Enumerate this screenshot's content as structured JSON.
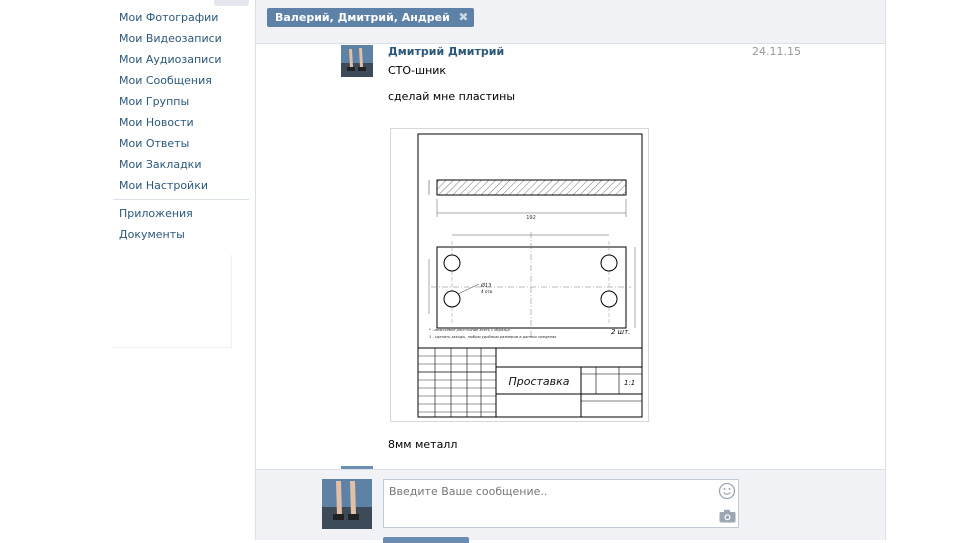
{
  "sidebar": {
    "items": [
      {
        "label": "Мои Фотографии"
      },
      {
        "label": "Мои Видеозаписи"
      },
      {
        "label": "Мои Аудиозаписи"
      },
      {
        "label": "Мои Сообщения"
      },
      {
        "label": "Мои Группы"
      },
      {
        "label": "Мои Новости"
      },
      {
        "label": "Мои Ответы"
      },
      {
        "label": "Мои Закладки"
      },
      {
        "label": "Мои Настройки"
      }
    ],
    "extra": [
      {
        "label": "Приложения"
      },
      {
        "label": "Документы"
      }
    ]
  },
  "chat": {
    "tab_label": "Валерий, Дмитрий, Андрей",
    "close_symbol": "✖"
  },
  "message": {
    "author": "Дмитрий Дмитрий",
    "date": "24.11.15",
    "line1": "СТО-шник",
    "line2": "сделай мне пластины",
    "line3": "8мм металл"
  },
  "drawing": {
    "title": "Проставка",
    "scale": "1:1",
    "quantity": "2 шт.",
    "dim_length": "192",
    "dim_hole": "Ø13",
    "dim_hole_note": "4 отв.",
    "note1": "* - межосевое расстояние взять с образца",
    "note2": "1 - сделать заходы, любым удобным размером в данных пределах"
  },
  "composer": {
    "placeholder": "Введите Ваше сообщение.."
  },
  "colors": {
    "link": "#2b587a",
    "tab": "#5e81a8",
    "panel": "#f0f2f5"
  }
}
